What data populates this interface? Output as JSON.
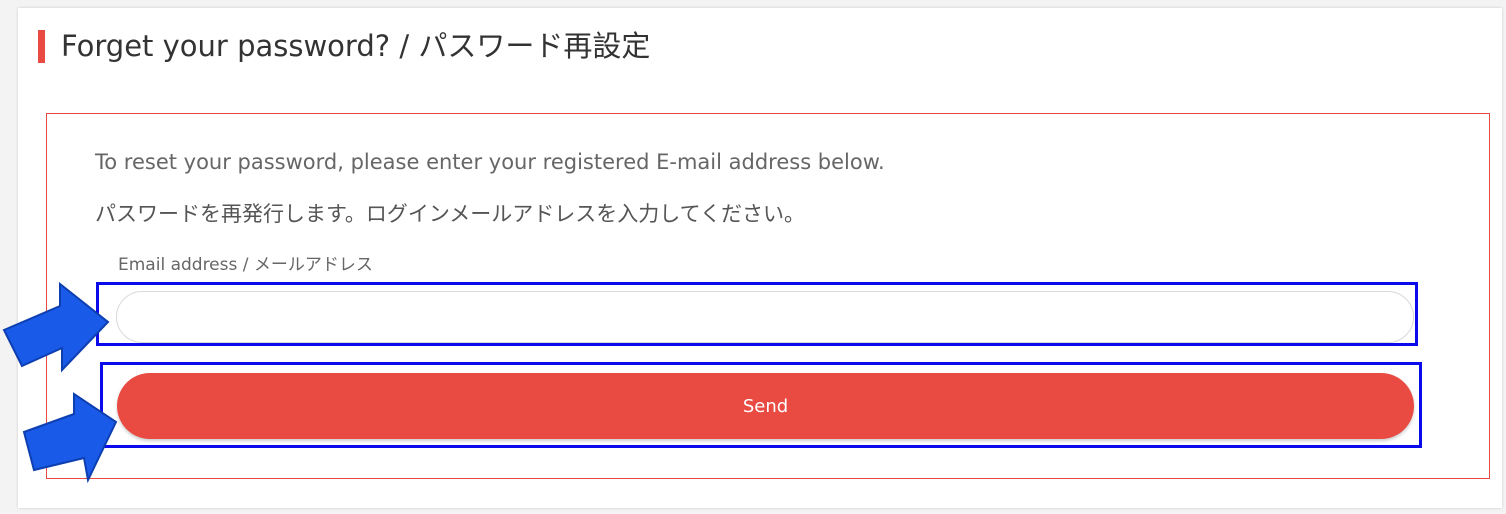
{
  "header": {
    "title": "Forget your password? / パスワード再設定"
  },
  "form": {
    "intro_en": "To reset your password, please enter your registered E-mail address below.",
    "intro_ja": "パスワードを再発行します。ログインメールアドレスを入力してください。",
    "email_label": "Email address / メールアドレス",
    "email_value": "",
    "send_label": "Send"
  },
  "colors": {
    "accent": "#e94b43",
    "highlight": "#0a0aea",
    "arrow": "#1a5ae8"
  },
  "annotations": {
    "arrow_icon": "arrow-right-icon"
  }
}
